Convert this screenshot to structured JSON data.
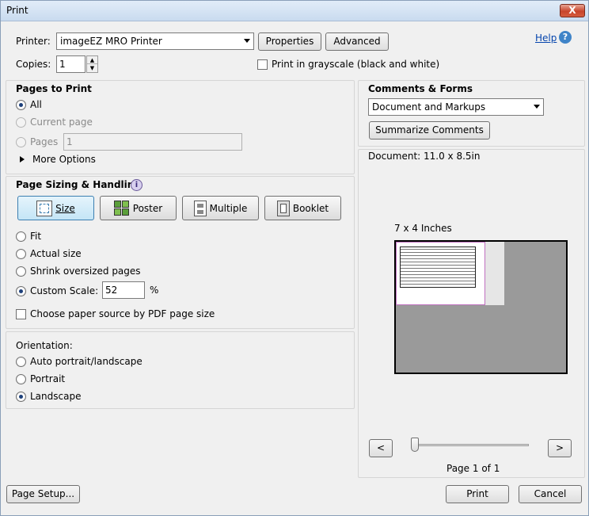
{
  "window": {
    "title": "Print",
    "close_glyph": "X"
  },
  "printer": {
    "label": "Printer:",
    "selected": "imageEZ MRO Printer",
    "properties_label": "Properties",
    "advanced_label": "Advanced",
    "help_label": "Help"
  },
  "copies": {
    "label": "Copies:",
    "value": "1",
    "grayscale_label": "Print in grayscale (black and white)"
  },
  "pages_to_print": {
    "heading": "Pages to Print",
    "all_label": "All",
    "current_label": "Current page",
    "pages_label": "Pages",
    "pages_value": "1",
    "more_options_label": "More Options"
  },
  "sizing": {
    "heading": "Page Sizing & Handling",
    "tabs": [
      "Size",
      "Poster",
      "Multiple",
      "Booklet"
    ],
    "fit_label": "Fit",
    "actual_label": "Actual size",
    "shrink_label": "Shrink oversized pages",
    "custom_label": "Custom Scale:",
    "custom_value": "52",
    "percent": "%",
    "paper_source_label": "Choose paper source by PDF page size"
  },
  "orientation": {
    "heading": "Orientation:",
    "auto_label": "Auto portrait/landscape",
    "portrait_label": "Portrait",
    "landscape_label": "Landscape"
  },
  "comments": {
    "heading": "Comments & Forms",
    "selected": "Document and Markups",
    "summarize_label": "Summarize Comments"
  },
  "preview": {
    "document_size": "Document: 11.0 x 8.5in",
    "paper_size": "7 x 4 Inches",
    "prev_glyph": "<",
    "next_glyph": ">",
    "page_indicator": "Page 1 of 1"
  },
  "footer": {
    "page_setup_label": "Page Setup...",
    "print_label": "Print",
    "cancel_label": "Cancel"
  }
}
